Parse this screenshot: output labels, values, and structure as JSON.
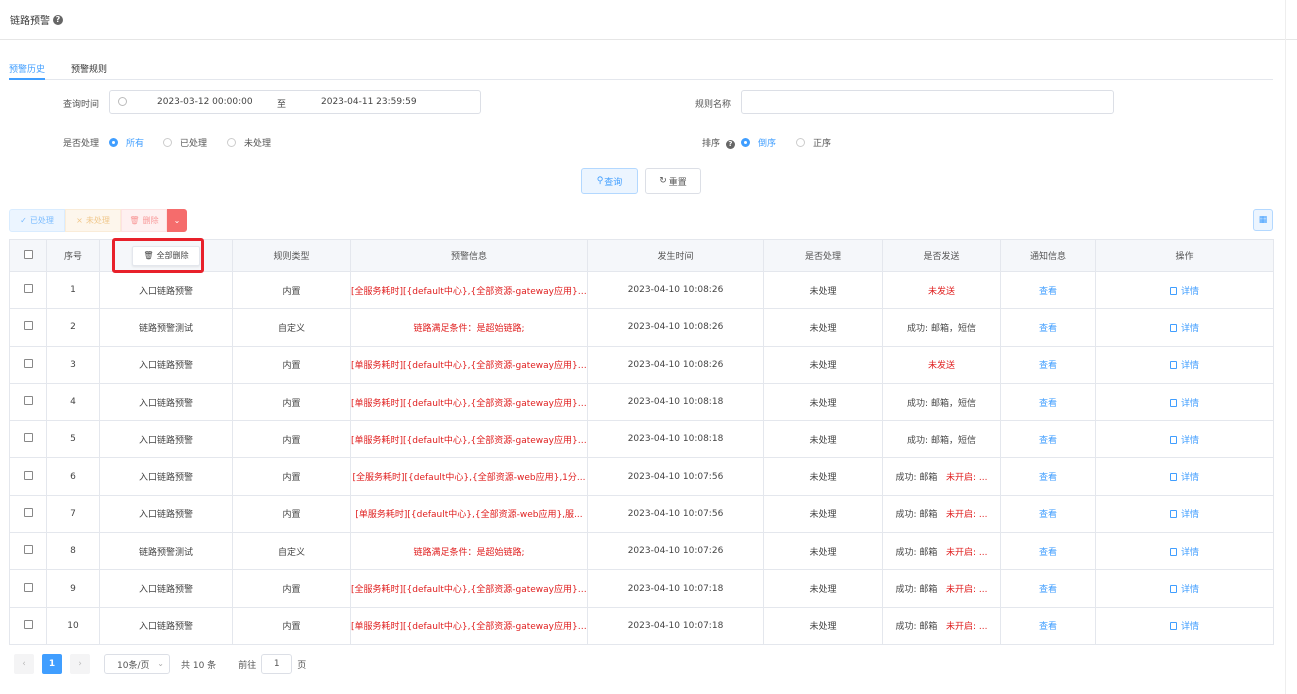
{
  "header": {
    "title": "链路预警",
    "help_icon": "?"
  },
  "tabs": [
    {
      "label": "预警历史",
      "active": true
    },
    {
      "label": "预警规则",
      "active": false
    }
  ],
  "filters": {
    "query_time_label": "查询时间",
    "start": "2023-03-12 00:00:00",
    "range_sep": "至",
    "end": "2023-04-11 23:59:59",
    "rule_name_label": "规则名称",
    "rule_name_value": "",
    "handled_label": "是否处理",
    "handled_options": [
      "所有",
      "已处理",
      "未处理"
    ],
    "handled_selected": "所有",
    "sort_label": "排序",
    "sort_options": [
      "倒序",
      "正序"
    ],
    "sort_selected": "倒序",
    "query_button": "查询",
    "reset_button": "重置"
  },
  "toolbar": {
    "done": "已处理",
    "undone": "未处理",
    "delete": "删除",
    "dropdown": "⌄"
  },
  "table": {
    "columns": [
      "序号",
      "规则类型",
      "预警信息",
      "发生时间",
      "是否处理",
      "是否发送",
      "通知信息",
      "操作"
    ],
    "delete_all_button": "全部删除",
    "view_link": "查看",
    "detail_link": "详情",
    "rows": [
      {
        "no": "1",
        "name": "入口链路预警",
        "type": "内置",
        "info": "[全服务耗时][{default中心},{全部资源-gateway应用},...",
        "info_red": true,
        "time": "2023-04-10 10:08:26",
        "handled": "未处理",
        "sent": "未发送",
        "sent_mode": "red"
      },
      {
        "no": "2",
        "name": "链路预警测试",
        "type": "自定义",
        "info": "链路满足条件：是超始链路;",
        "info_red": true,
        "time": "2023-04-10 10:08:26",
        "handled": "未处理",
        "sent": "成功: 邮箱，短信",
        "sent_mode": "plain"
      },
      {
        "no": "3",
        "name": "入口链路预警",
        "type": "内置",
        "info": "[单服务耗时][{default中心},{全部资源-gateway应用},...",
        "info_red": true,
        "time": "2023-04-10 10:08:26",
        "handled": "未处理",
        "sent": "未发送",
        "sent_mode": "red"
      },
      {
        "no": "4",
        "name": "入口链路预警",
        "type": "内置",
        "info": "[单服务耗时][{default中心},{全部资源-gateway应用},...",
        "info_red": true,
        "time": "2023-04-10 10:08:18",
        "handled": "未处理",
        "sent": "成功: 邮箱，短信",
        "sent_mode": "plain"
      },
      {
        "no": "5",
        "name": "入口链路预警",
        "type": "内置",
        "info": "[单服务耗时][{default中心},{全部资源-gateway应用},...",
        "info_red": true,
        "time": "2023-04-10 10:08:18",
        "handled": "未处理",
        "sent": "成功: 邮箱，短信",
        "sent_mode": "plain"
      },
      {
        "no": "6",
        "name": "入口链路预警",
        "type": "内置",
        "info": "[全服务耗时][{default中心},{全部资源-web应用},1分...",
        "info_red": true,
        "time": "2023-04-10 10:07:56",
        "handled": "未处理",
        "sent": "成功: 邮箱",
        "sent_extra": "未开启: ...",
        "sent_mode": "mixed"
      },
      {
        "no": "7",
        "name": "入口链路预警",
        "type": "内置",
        "info": "[单服务耗时][{default中心},{全部资源-web应用},服...",
        "info_red": true,
        "time": "2023-04-10 10:07:56",
        "handled": "未处理",
        "sent": "成功: 邮箱",
        "sent_extra": "未开启: ...",
        "sent_mode": "mixed"
      },
      {
        "no": "8",
        "name": "链路预警测试",
        "type": "自定义",
        "info": "链路满足条件：是超始链路;",
        "info_red": true,
        "time": "2023-04-10 10:07:26",
        "handled": "未处理",
        "sent": "成功: 邮箱",
        "sent_extra": "未开启: ...",
        "sent_mode": "mixed"
      },
      {
        "no": "9",
        "name": "入口链路预警",
        "type": "内置",
        "info": "[全服务耗时][{default中心},{全部资源-gateway应用},...",
        "info_red": true,
        "time": "2023-04-10 10:07:18",
        "handled": "未处理",
        "sent": "成功: 邮箱",
        "sent_extra": "未开启: ...",
        "sent_mode": "mixed"
      },
      {
        "no": "10",
        "name": "入口链路预警",
        "type": "内置",
        "info": "[单服务耗时][{default中心},{全部资源-gateway应用},...",
        "info_red": true,
        "time": "2023-04-10 10:07:18",
        "handled": "未处理",
        "sent": "成功: 邮箱",
        "sent_extra": "未开启: ...",
        "sent_mode": "mixed"
      }
    ]
  },
  "pager": {
    "current": "1",
    "page_size": "10条/页",
    "total": "共 10 条",
    "goto_prefix": "前往",
    "goto_value": "1",
    "goto_suffix": "页"
  }
}
